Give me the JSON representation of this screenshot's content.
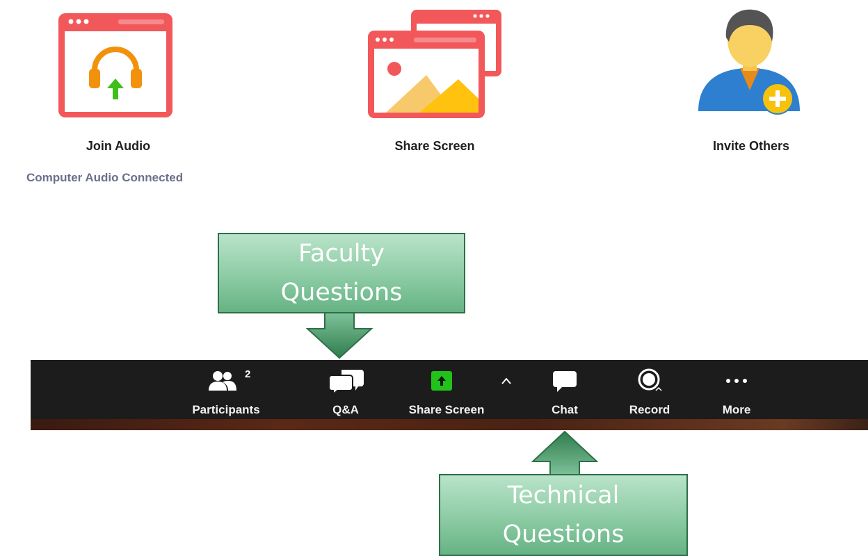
{
  "actions": {
    "join_audio": {
      "label": "Join Audio",
      "status": "Computer Audio Connected"
    },
    "share_screen": {
      "label": "Share Screen"
    },
    "invite_others": {
      "label": "Invite Others"
    }
  },
  "callouts": {
    "faculty": {
      "line1": "Faculty",
      "line2": "Questions"
    },
    "technical": {
      "line1": "Technical",
      "line2": "Questions"
    }
  },
  "toolbar": {
    "participants": {
      "label": "Participants",
      "count": "2",
      "icon": "participants-icon"
    },
    "qa": {
      "label": "Q&A",
      "icon": "qa-icon"
    },
    "share_screen": {
      "label": "Share Screen",
      "icon": "share-screen-icon"
    },
    "share_options": {
      "icon": "chevron-up-icon"
    },
    "chat": {
      "label": "Chat",
      "icon": "chat-icon"
    },
    "record": {
      "label": "Record",
      "icon": "record-icon"
    },
    "more": {
      "label": "More",
      "icon": "ellipsis-icon"
    }
  },
  "colors": {
    "tile_red": "#f2585a",
    "headphone_orange": "#f2920c",
    "arrow_green": "#3fbf1a",
    "toolbar_bg": "#1c1c1c",
    "share_green": "#22c21a",
    "callout_border": "#2e6f47",
    "arrow_fill": "#2f7d4d"
  }
}
